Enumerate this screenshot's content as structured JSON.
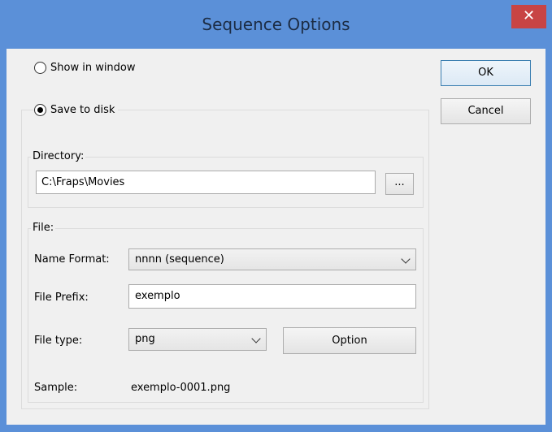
{
  "window": {
    "title": "Sequence Options",
    "close_glyph": "✕"
  },
  "display": {
    "show_in_window_label": "Show in window",
    "save_to_disk_label": "Save to disk",
    "selected": "save_to_disk"
  },
  "buttons": {
    "ok_label": "OK",
    "cancel_label": "Cancel"
  },
  "directory": {
    "legend": "Directory:",
    "value": "C:\\Fraps\\Movies",
    "browse_label": "..."
  },
  "file": {
    "legend": "File:",
    "name_format_label": "Name Format:",
    "name_format_value": "nnnn (sequence)",
    "file_prefix_label": "File Prefix:",
    "file_prefix_value": "exemplo",
    "file_type_label": "File type:",
    "file_type_value": "png",
    "option_label": "Option",
    "sample_label": "Sample:",
    "sample_value": "exemplo-0001.png"
  }
}
